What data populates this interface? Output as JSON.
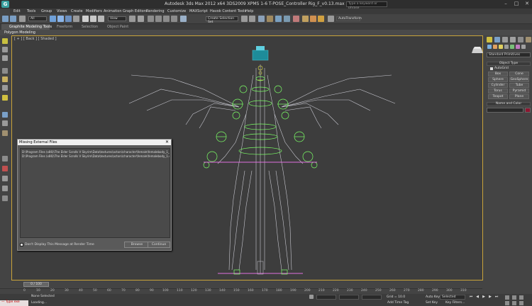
{
  "app": {
    "logo": "G",
    "title": "Autodesk 3ds Max  2012 x64        3DS2009 XPMS 1-6 T-POSE_Controller Rig_F_v0.13.max",
    "search_placeholder": "Type a keyword or phrase",
    "controls": {
      "minimize": "–",
      "maximize": "□",
      "close": "✕"
    }
  },
  "menu": [
    "Edit",
    "Tools",
    "Group",
    "Views",
    "Create",
    "Modifiers",
    "Animation",
    "Graph Editors",
    "Rendering",
    "Customize",
    "MAXScript",
    "Havok Content Tools",
    "Help"
  ],
  "toolbar": {
    "selection_filter": "All",
    "reference_coord": "View",
    "named_selection": "Create Selection Set",
    "extra_button": "AutoTransform"
  },
  "ribbon": {
    "tabs": [
      "Graphite Modeling Tools",
      "Freeform",
      "Selection",
      "Object Paint"
    ],
    "panel": "Polygon Modeling"
  },
  "viewport": {
    "label": "[ + ] [ Back ] [ Shaded ]"
  },
  "dialog": {
    "title": "Missing External Files",
    "close": "✕",
    "files": [
      "D:\\Program Files (x86)\\The Elder Scrolls V Skyrim\\Data\\textures\\actors\\character\\female\\femalebody_1_sk.dds",
      "D:\\Program Files (x86)\\The Elder Scrolls V Skyrim\\Data\\textures\\actors\\character\\female\\femalebody_1.dds"
    ],
    "checkbox_label": "Don't Display This Message at Render Time",
    "browse": "Browse",
    "continue": "Continue"
  },
  "command_panel": {
    "dropdown": "Standard Primitives",
    "object_type_header": "Object Type",
    "autogrid": "AutoGrid",
    "primitives": [
      "Box",
      "Cone",
      "Sphere",
      "GeoSphere",
      "Cylinder",
      "Tube",
      "Torus",
      "Pyramid",
      "Teapot",
      "Plane"
    ],
    "name_color_header": "Name and Color"
  },
  "timeline": {
    "slider": "0 / 100",
    "ticks": [
      "0",
      "10",
      "20",
      "30",
      "40",
      "50",
      "60",
      "70",
      "80",
      "90",
      "100",
      "110",
      "120",
      "130",
      "140",
      "150",
      "160",
      "170",
      "180",
      "190",
      "200",
      "210",
      "220",
      "230",
      "240",
      "250",
      "260",
      "270",
      "280",
      "290",
      "300",
      "310"
    ]
  },
  "status": {
    "maxscript": "— Type exe",
    "selection": "None Selected",
    "prompt": "Loading...",
    "grid": "Grid = 10.0",
    "add_time_tag": "Add Time Tag",
    "auto_key": "Auto Key",
    "set_key": "Set Key",
    "key_mode": "Selected",
    "key_filters": "Key Filters..."
  },
  "colors": {
    "viewport_border": "#c9a33a",
    "rig_lines": "#c8c8d0",
    "controller_green": "#7cff66",
    "controller_yellow": "#e6e645",
    "controller_magenta": "#e070e0",
    "object_color": "#8c1630"
  }
}
